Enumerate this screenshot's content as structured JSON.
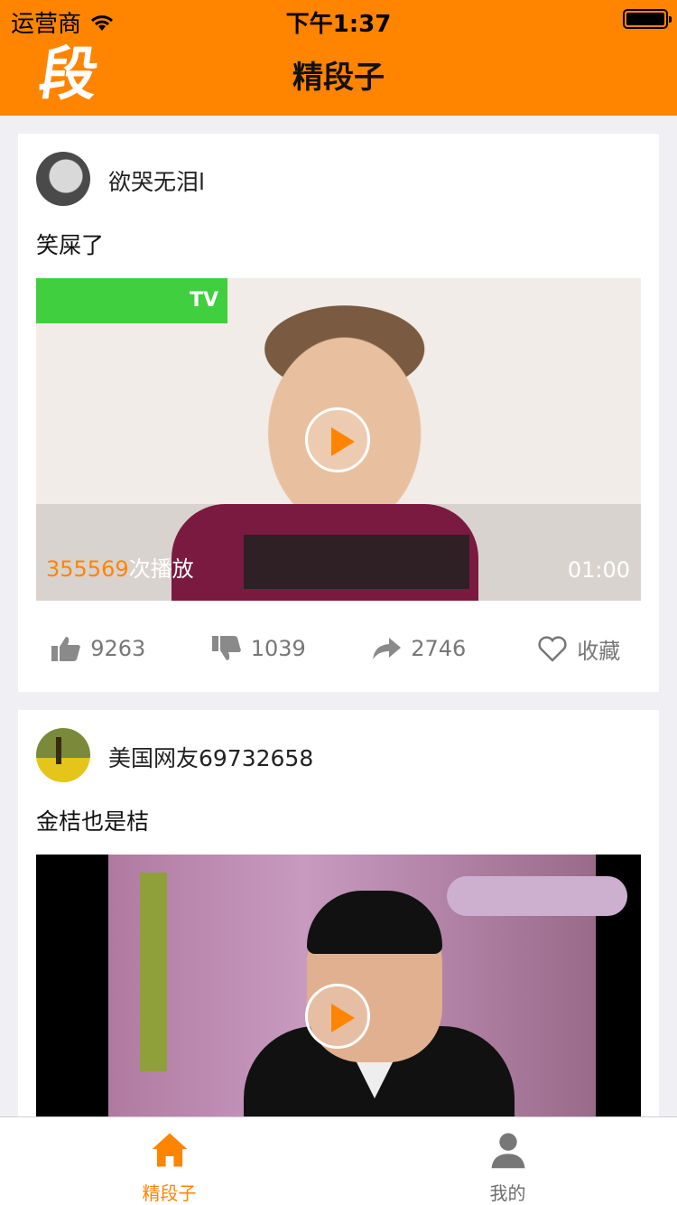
{
  "status_bar": {
    "carrier": "运营商",
    "time": "下午1:37"
  },
  "nav": {
    "logo_text": "段",
    "title": "精段子"
  },
  "posts": [
    {
      "username": "欲哭无泪l",
      "caption": "笑屎了",
      "play_count": "355569",
      "play_suffix": "次播放",
      "duration": "01:00",
      "likes": "9263",
      "dislikes": "1039",
      "shares": "2746",
      "favorite_label": "收藏"
    },
    {
      "username": "美国网友69732658",
      "caption": "金桔也是桔"
    }
  ],
  "tabs": [
    {
      "label": "精段子",
      "icon": "home-icon",
      "active": true
    },
    {
      "label": "我的",
      "icon": "person-icon",
      "active": false
    }
  ],
  "colors": {
    "accent": "#ff8400",
    "background": "#efeff4"
  }
}
